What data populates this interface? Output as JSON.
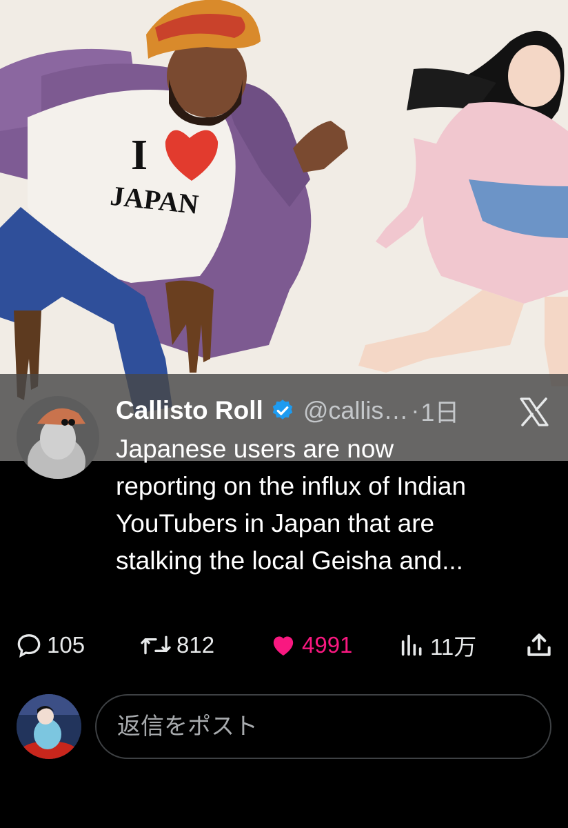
{
  "image": {
    "shirt_text_top": "I",
    "shirt_text_bottom": "JAPAN"
  },
  "tweet": {
    "author_name": "Callisto Roll",
    "handle": "@callis…",
    "separator": "·",
    "time": "1日",
    "text": "Japanese users are now\nreporting on the influx of Indian\nYouTubers in Japan that are\nstalking the local Geisha and...",
    "verified_icon": "verified-badge-icon",
    "platform_icon": "x-logo-icon"
  },
  "actions": {
    "replies": "105",
    "reposts": "812",
    "likes": "4991",
    "views": "11万",
    "like_color": "#f91880"
  },
  "reply": {
    "placeholder": "返信をポスト"
  },
  "colors": {
    "background": "#000000",
    "verified": "#1d9bf0",
    "text": "#e7e9ea"
  }
}
